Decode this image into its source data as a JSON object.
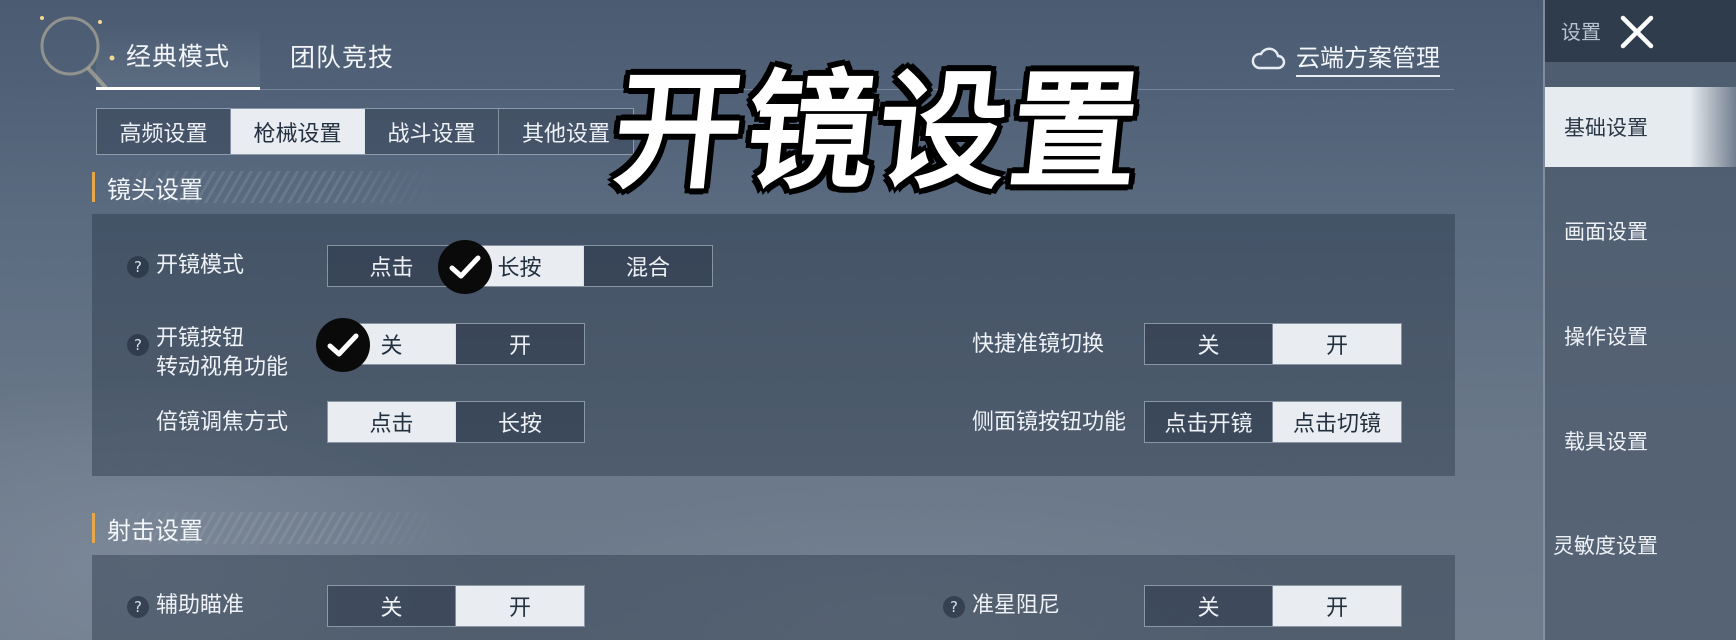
{
  "overlay_title": "开镜设置",
  "mode_tabs": [
    {
      "label": "经典模式",
      "active": true
    },
    {
      "label": "团队竞技",
      "active": false
    }
  ],
  "cloud_link": "云端方案管理",
  "sub_tabs": [
    {
      "label": "高频设置",
      "active": false
    },
    {
      "label": "枪械设置",
      "active": true
    },
    {
      "label": "战斗设置",
      "active": false
    },
    {
      "label": "其他设置",
      "active": false
    }
  ],
  "sections": {
    "lens": {
      "title": "镜头设置",
      "scope_mode": {
        "label": "开镜模式",
        "options": [
          "点击",
          "长按",
          "混合"
        ],
        "selected": 1
      },
      "scope_turn": {
        "label_line1": "开镜按钮",
        "label_line2": "转动视角功能",
        "options": [
          "关",
          "开"
        ],
        "selected": 0
      },
      "quick_switch": {
        "label": "快捷准镜切换",
        "options": [
          "关",
          "开"
        ],
        "selected": 1
      },
      "zoom_method": {
        "label": "倍镜调焦方式",
        "options": [
          "点击",
          "长按"
        ],
        "selected": 0
      },
      "side_scope": {
        "label": "侧面镜按钮功能",
        "options": [
          "点击开镜",
          "点击切镜"
        ],
        "selected": 1
      }
    },
    "shooting": {
      "title": "射击设置",
      "aim_assist": {
        "label": "辅助瞄准",
        "options": [
          "关",
          "开"
        ],
        "selected": 1
      },
      "crosshair_damping": {
        "label": "准星阻尼",
        "options": [
          "关",
          "开"
        ],
        "selected": 1
      }
    }
  },
  "help_mark": "?",
  "sidebar": {
    "header": "设置",
    "items": [
      {
        "label": "基础设置",
        "active": true
      },
      {
        "label": "画面设置",
        "active": false
      },
      {
        "label": "操作设置",
        "active": false
      },
      {
        "label": "载具设置",
        "active": false
      },
      {
        "label": "灵敏度设置",
        "active": false
      }
    ]
  },
  "colors": {
    "accent": "#e8a847",
    "selected_bg": "#e9edf2",
    "sidebar_bg": "#4e5c6e"
  }
}
